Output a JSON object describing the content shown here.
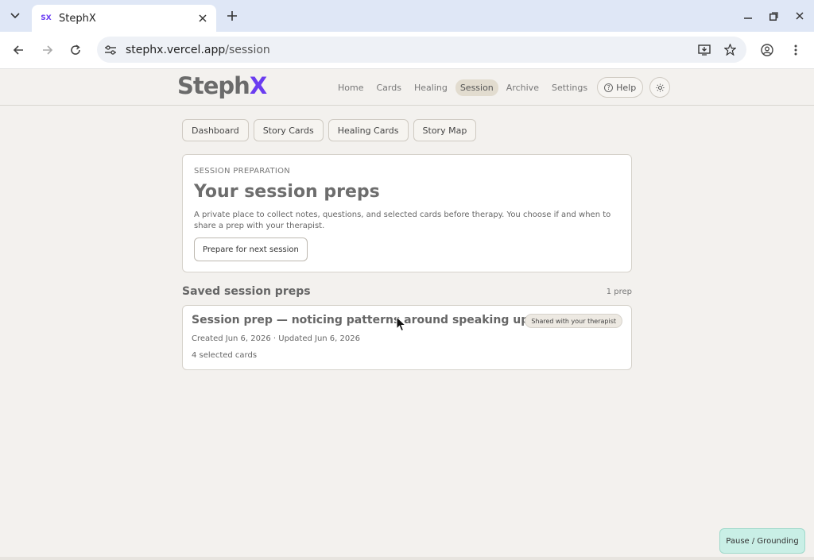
{
  "browser": {
    "tab_title": "StephX",
    "tab_favicon": "SX",
    "url_host": "stephx.vercel.app",
    "url_path": "/session"
  },
  "app": {
    "logo_main": "Steph",
    "logo_accent": "X",
    "accent_color": "#6a3cf0",
    "nav": [
      {
        "label": "Home",
        "active": false
      },
      {
        "label": "Cards",
        "active": false
      },
      {
        "label": "Healing",
        "active": false
      },
      {
        "label": "Session",
        "active": true
      },
      {
        "label": "Archive",
        "active": false
      },
      {
        "label": "Settings",
        "active": false
      }
    ],
    "help_label": "Help"
  },
  "subtabs": [
    "Dashboard",
    "Story Cards",
    "Healing Cards",
    "Story Map"
  ],
  "prep_section": {
    "eyebrow": "SESSION PREPARATION",
    "title": "Your session preps",
    "description": "A private place to collect notes, questions, and selected cards before therapy. You choose if and when to share a prep with your therapist.",
    "button_label": "Prepare for next session"
  },
  "saved": {
    "heading": "Saved session preps",
    "count": "1 prep",
    "items": [
      {
        "title": "Session prep — noticing patterns around speaking up",
        "badge": "Shared with your therapist",
        "meta": "Created Jun 6, 2026 · Updated Jun 6, 2026",
        "cards": "4 selected cards"
      }
    ]
  },
  "pause_label": "Pause / Grounding",
  "icons": {
    "tab_menu": "chevron-down-icon",
    "close": "close-icon",
    "new_tab": "plus-icon",
    "back": "arrow-left-icon",
    "forward": "arrow-right-icon",
    "reload": "reload-icon",
    "site_info": "tune-icon",
    "install": "install-icon",
    "bookmark": "star-icon",
    "profile": "account-icon",
    "menu": "kebab-menu-icon",
    "theme": "sun-icon"
  }
}
